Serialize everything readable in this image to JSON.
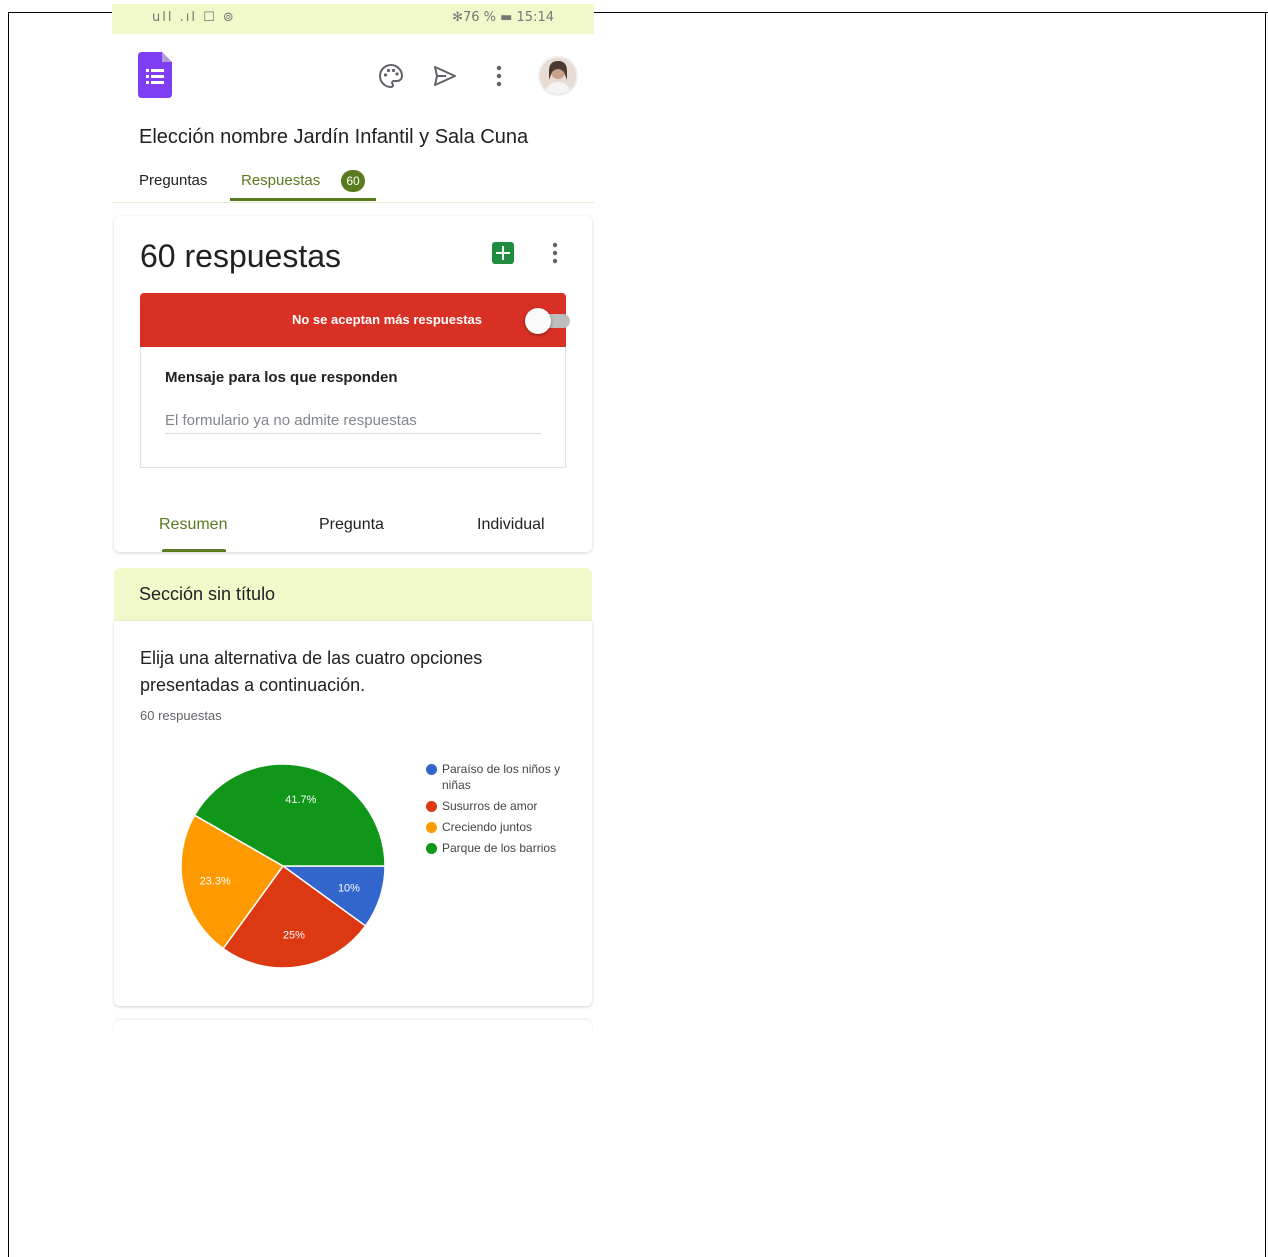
{
  "statusbar": {
    "left": "ull .ıl ☐ ⊚",
    "right": "✻76 % ▬ 15:14"
  },
  "app": {
    "form_title": "Elección nombre Jardín Infantil y Sala Cuna",
    "icons": [
      "forms-logo-icon",
      "palette-icon",
      "send-icon",
      "more-vert-icon",
      "avatar"
    ]
  },
  "tabs": {
    "preguntas": "Preguntas",
    "respuestas": "Respuestas",
    "respuestas_badge": "60"
  },
  "responses_card": {
    "count_label": "60 respuestas",
    "accepting_text": "No se aceptan más respuestas",
    "accepting_on": false,
    "message_label": "Mensaje para los que responden",
    "message_placeholder": "El formulario ya no admite respuestas",
    "sub_tabs": [
      "Resumen",
      "Pregunta",
      "Individual"
    ],
    "active_sub_tab": "Resumen"
  },
  "section": {
    "title": "Sección sin título"
  },
  "question": {
    "text": "Elija una alternativa de las cuatro opciones presentadas a continuación.",
    "count": "60 respuestas"
  },
  "colors": {
    "accent": "#5a7a1e",
    "status_bar": "#f1f8c9",
    "toggle_bar": "#d93025"
  },
  "chart_data": {
    "type": "pie",
    "categories": [
      "Paraíso de los niños y niñas",
      "Susurros de amor",
      "Creciendo juntos",
      "Parque de los barrios"
    ],
    "values": [
      10,
      25,
      23.3,
      41.7
    ],
    "labels": [
      "10%",
      "25%",
      "23.3%",
      "41.7%"
    ],
    "colors": [
      "#3366cc",
      "#dc3912",
      "#ff9900",
      "#109618"
    ],
    "legend": "right"
  }
}
